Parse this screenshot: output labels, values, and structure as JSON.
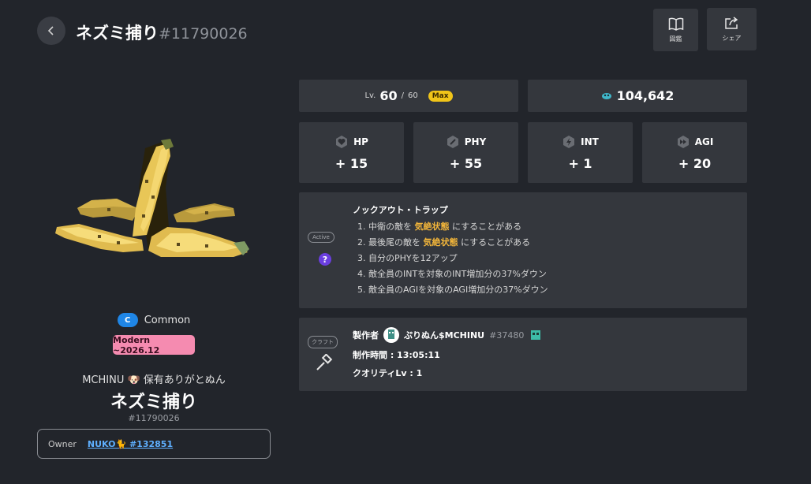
{
  "header": {
    "item_name": "ネズミ捕り",
    "item_id": "#11790026",
    "buttons": [
      {
        "label": "図鑑",
        "icon": "book-icon"
      },
      {
        "label": "シェア",
        "icon": "share-icon"
      }
    ]
  },
  "level": {
    "prefix": "Lv.",
    "current": "60",
    "separator": "/",
    "max": "60",
    "badge": "Max"
  },
  "currency": {
    "icon": "coin-icon",
    "value": "104,642"
  },
  "stats": [
    {
      "name": "HP",
      "value": "+ 15",
      "icon": "heart-icon"
    },
    {
      "name": "PHY",
      "value": "+ 55",
      "icon": "sword-icon"
    },
    {
      "name": "INT",
      "value": "+ 1",
      "icon": "lightning-icon"
    },
    {
      "name": "AGI",
      "value": "+ 20",
      "icon": "fast-forward-icon"
    }
  ],
  "skill": {
    "tag": "Active",
    "icon": "question-icon",
    "title": "ノックアウト・トラップ",
    "lines": [
      {
        "pre": "1. 中衛の敵を ",
        "hl": "気絶状態",
        "post": " にすることがある"
      },
      {
        "pre": "2. 最後尾の敵を ",
        "hl": "気絶状態",
        "post": " にすることがある"
      },
      {
        "pre": "3. 自分のPHYを12アップ",
        "hl": "",
        "post": ""
      },
      {
        "pre": "4. 敵全員のINTを対象のINT増加分の37%ダウン",
        "hl": "",
        "post": ""
      },
      {
        "pre": "5. 敵全員のAGIを対象のAGI増加分の37%ダウン",
        "hl": "",
        "post": ""
      }
    ]
  },
  "craft": {
    "tag": "クラフト",
    "icon": "hammer-icon",
    "maker_label": "製作者",
    "maker_name": "ぷりぬん$MCHINU",
    "maker_id": "#37480",
    "time": "制作時間 : 13:05:11",
    "quality": "クオリティLv : 1"
  },
  "item": {
    "rarity_letter": "C",
    "rarity": "Common",
    "season": "Modern ~2026.12",
    "note": "MCHINU 🐶 保有ありがとぬん",
    "name": "ネズミ捕り",
    "id": "#11790026"
  },
  "owner": {
    "label": "Owner",
    "name": "NUKO🐈 #132851"
  },
  "colors": {
    "background": "#22252b",
    "panel": "#34373d",
    "highlight": "#f2b53a",
    "max_badge": "#f0c419",
    "rarity_badge": "#1f86e6",
    "season_badge": "#f58bb0",
    "link": "#5fb0ff"
  }
}
